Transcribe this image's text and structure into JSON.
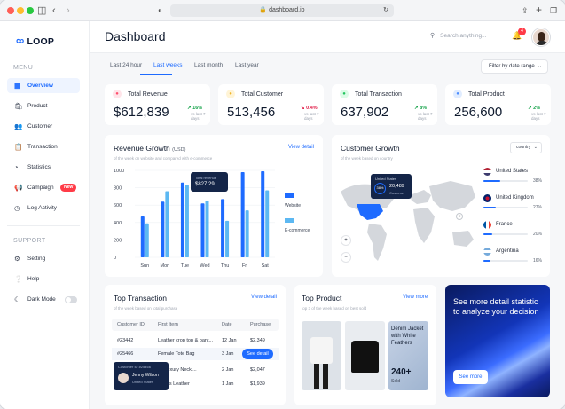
{
  "browser": {
    "url": "dashboard.io"
  },
  "brand": {
    "name": "LOOP"
  },
  "sidebar": {
    "menu_heading": "MENU",
    "items": [
      {
        "label": "Overview"
      },
      {
        "label": "Product"
      },
      {
        "label": "Customer"
      },
      {
        "label": "Transaction"
      },
      {
        "label": "Statistics"
      },
      {
        "label": "Campaign",
        "badge": "New"
      },
      {
        "label": "Log Activity"
      }
    ],
    "support_heading": "SUPPORT",
    "support_items": [
      {
        "label": "Setting"
      },
      {
        "label": "Help"
      },
      {
        "label": "Dark Mode"
      }
    ]
  },
  "header": {
    "title": "Dashboard",
    "search_placeholder": "Search anything...",
    "notification_count": "4"
  },
  "tabs": [
    "Last 24 hour",
    "Last weeks",
    "Last month",
    "Last year"
  ],
  "filter_label": "Filter by date range",
  "stats": [
    {
      "label": "Total Revenue",
      "value": "$612,839",
      "change": "16%",
      "direction": "up",
      "note": "vs last 7 days",
      "accent": "#ff4d6d"
    },
    {
      "label": "Total Customer",
      "value": "513,456",
      "change": "0.4%",
      "direction": "down",
      "note": "vs last 7 days",
      "accent": "#f0b429"
    },
    {
      "label": "Total Transaction",
      "value": "637,902",
      "change": "8%",
      "direction": "up",
      "note": "vs last 7 days",
      "accent": "#22c55e"
    },
    {
      "label": "Total Product",
      "value": "256,600",
      "change": "2%",
      "direction": "up",
      "note": "vs last 7 days",
      "accent": "#4b8cff"
    }
  ],
  "revenue": {
    "title": "Revenue Growth",
    "unit": "(USD)",
    "subtitle": "of the week on website and compared with e-commerce",
    "link": "View detail",
    "tooltip_label": "Total revenue",
    "tooltip_value": "$827.29",
    "legend": [
      "Website",
      "E-commerce"
    ]
  },
  "chart_data": {
    "type": "bar",
    "categories": [
      "Sun",
      "Mon",
      "Tue",
      "Wed",
      "Thu",
      "Fri",
      "Sat"
    ],
    "yticks": [
      "1000",
      "800",
      "600",
      "400",
      "200",
      "0"
    ],
    "ylim": [
      0,
      1000
    ],
    "series": [
      {
        "name": "Website",
        "color": "#1e6bff",
        "values": [
          470,
          640,
          860,
          620,
          670,
          980,
          990
        ]
      },
      {
        "name": "E-commerce",
        "color": "#5cb8f2",
        "values": [
          390,
          760,
          830,
          650,
          420,
          540,
          770
        ]
      }
    ]
  },
  "customer_growth": {
    "title": "Customer Growth",
    "subtitle": "of the week based on country",
    "dropdown": "country",
    "map_tooltip": {
      "country": "United States",
      "percent": "38%",
      "value": "20,489",
      "label": "Customer"
    },
    "countries": [
      {
        "name": "United States",
        "percent": "38%",
        "fill": 0.38
      },
      {
        "name": "United Kingdom",
        "percent": "27%",
        "fill": 0.27
      },
      {
        "name": "France",
        "percent": "20%",
        "fill": 0.2
      },
      {
        "name": "Argentina",
        "percent": "16%",
        "fill": 0.16
      }
    ]
  },
  "transactions": {
    "title": "Top Transaction",
    "subtitle": "of the week based on total purchase",
    "link": "View detail",
    "columns": [
      "Customer ID",
      "First Item",
      "Date",
      "Purchase"
    ],
    "rows": [
      {
        "id": "#23442",
        "item": "Leather crop top & pant...",
        "date": "12 Jan",
        "amount": "$2,349"
      },
      {
        "id": "#25466",
        "item": "Female Tote Bag",
        "date": "3 Jan",
        "amount": "",
        "action": "See detail"
      },
      {
        "id": "",
        "item": "se Luxury Neckl...",
        "date": "2 Jan",
        "amount": "$2,047"
      },
      {
        "id": "",
        "item": "Shoes Leather",
        "date": "1 Jan",
        "amount": "$1,939"
      }
    ],
    "popover": {
      "label": "Customer ID",
      "id": "#25466",
      "name": "Jenny Wilson",
      "country": "United States"
    }
  },
  "top_product": {
    "title": "Top Product",
    "subtitle": "top 3 of the week based on best sold",
    "link": "View more",
    "product_name": "Denim Jacket with White Feathers",
    "sold": "240+",
    "sold_label": "Sold"
  },
  "promo": {
    "text": "See more detail statistic to analyze your decision",
    "button": "See more"
  }
}
